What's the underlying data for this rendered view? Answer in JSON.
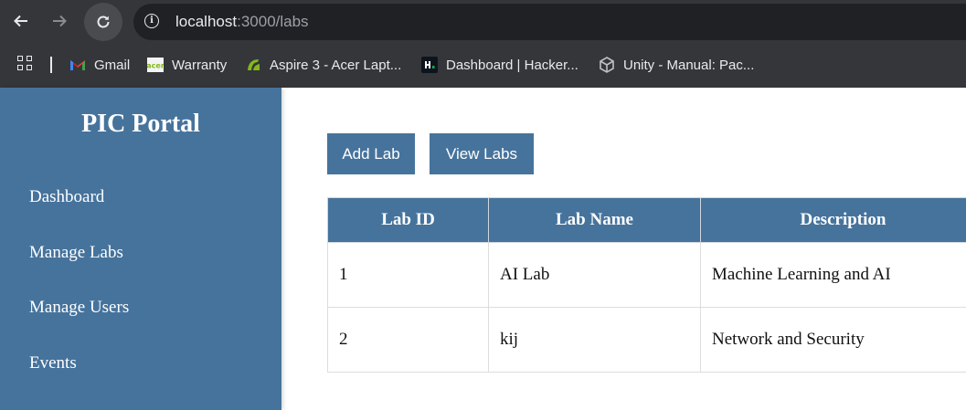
{
  "browser": {
    "url_host": "localhost",
    "url_path": ":3000/labs",
    "bookmarks": [
      {
        "label": "Gmail",
        "icon": "gmail-icon"
      },
      {
        "label": "Warranty",
        "icon": "acer-icon"
      },
      {
        "label": "Aspire 3 - Acer Lapt...",
        "icon": "acer-green-icon"
      },
      {
        "label": "Dashboard | Hacker...",
        "icon": "hackerrank-icon"
      },
      {
        "label": "Unity - Manual: Pac...",
        "icon": "unity-icon"
      }
    ]
  },
  "sidebar": {
    "brand": "PIC Portal",
    "items": [
      {
        "label": "Dashboard"
      },
      {
        "label": "Manage Labs"
      },
      {
        "label": "Manage Users"
      },
      {
        "label": "Events"
      }
    ]
  },
  "toolbar": {
    "add_label": "Add Lab",
    "view_label": "View Labs"
  },
  "table": {
    "headers": [
      "Lab ID",
      "Lab Name",
      "Description"
    ],
    "rows": [
      [
        "1",
        "AI Lab",
        "Machine Learning and AI"
      ],
      [
        "2",
        "kij",
        "Network and Security"
      ]
    ]
  },
  "colors": {
    "accent": "#46739c",
    "chrome": "#35363a",
    "omnibox": "#202124"
  }
}
